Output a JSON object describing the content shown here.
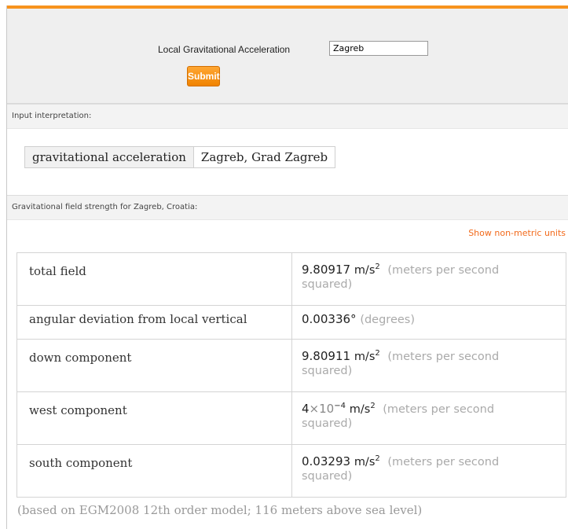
{
  "form": {
    "label": "Local Gravitational Acceleration",
    "input_value": "Zagreb",
    "submit_label": "Submit"
  },
  "input_pod": {
    "title": "Input interpretation:",
    "key": "gravitational acceleration",
    "value": "Zagreb, Grad Zagreb"
  },
  "result_pod": {
    "title": "Gravitational field strength for Zagreb, Croatia:",
    "units_link": "Show non-metric units",
    "rows": [
      {
        "label": "total field",
        "value": "9.80917",
        "unit": "m/s",
        "exp": "2",
        "desc1": "(meters per second",
        "desc2": "squared)"
      },
      {
        "label": "angular deviation from local vertical",
        "value": "0.00336°",
        "desc1": "(degrees)"
      },
      {
        "label": "down component",
        "value": "9.80911",
        "unit": "m/s",
        "exp": "2",
        "desc1": "(meters per second",
        "desc2": "squared)"
      },
      {
        "label": "west component",
        "value_base": "4",
        "value_times": "×10",
        "value_exp": "−4",
        "unit": "m/s",
        "exp": "2",
        "desc1": "(meters per second",
        "desc2": "squared)"
      },
      {
        "label": "south component",
        "value": "0.03293",
        "unit": "m/s",
        "exp": "2",
        "desc1": "(meters per second",
        "desc2": "squared)"
      }
    ],
    "footnote": "(based on EGM2008 12th order model;  116 meters above sea level)"
  }
}
